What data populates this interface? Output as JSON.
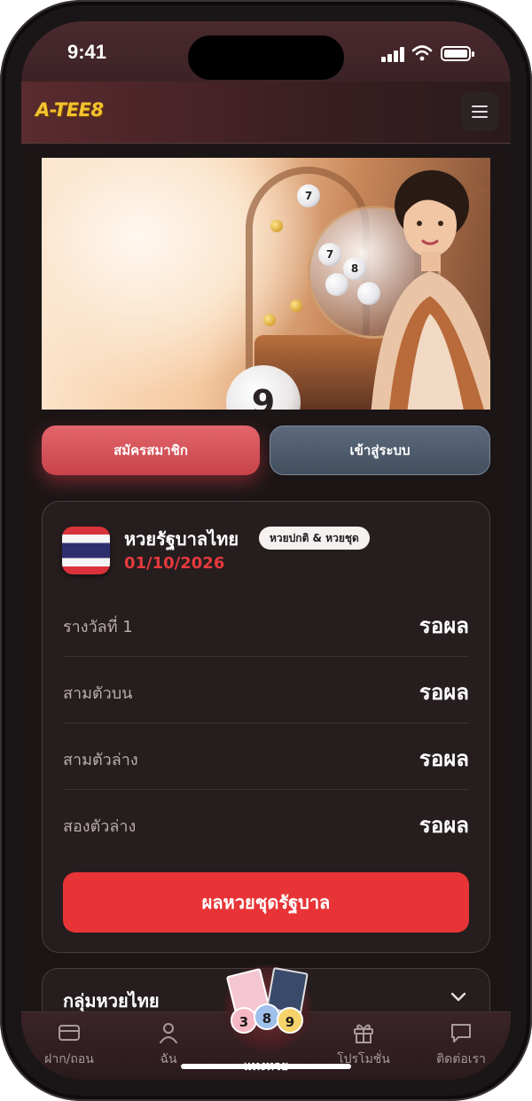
{
  "status_bar": {
    "time": "9:41"
  },
  "header": {
    "logo": "A-TEE8"
  },
  "hero": {
    "big_ball_number": "9",
    "ball_numbers": [
      "7",
      "8",
      "7"
    ]
  },
  "auth": {
    "register_label": "สมัครสมาชิก",
    "login_label": "เข้าสู่ระบบ"
  },
  "lottery_card": {
    "title": "หวยรัฐบาลไทย",
    "badge": "หวยปกติ & หวยชุด",
    "date": "01/10/2026",
    "rows": [
      {
        "label": "รางวัลที่ 1",
        "value": "รอผล"
      },
      {
        "label": "สามตัวบน",
        "value": "รอผล"
      },
      {
        "label": "สามตัวล่าง",
        "value": "รอผล"
      },
      {
        "label": "สองตัวล่าง",
        "value": "รอผล"
      }
    ],
    "result_button": "ผลหวยชุดรัฐบาล"
  },
  "group_card": {
    "title": "กลุ่มหวยไทย"
  },
  "bottom_nav": {
    "items": [
      {
        "label": "ฝาก/ถอน",
        "icon": "card-icon"
      },
      {
        "label": "ฉัน",
        "icon": "user-icon"
      },
      {
        "label": "แทงหวย",
        "icon": "lottery-icon"
      },
      {
        "label": "โปรโมชั่น",
        "icon": "gift-icon"
      },
      {
        "label": "ติดต่อเรา",
        "icon": "chat-icon"
      }
    ],
    "lotto_balls": [
      "3",
      "8",
      "9"
    ]
  },
  "colors": {
    "accent_red": "#e83436",
    "logo_gold": "#f4c330",
    "date_red": "#e53a3e"
  }
}
